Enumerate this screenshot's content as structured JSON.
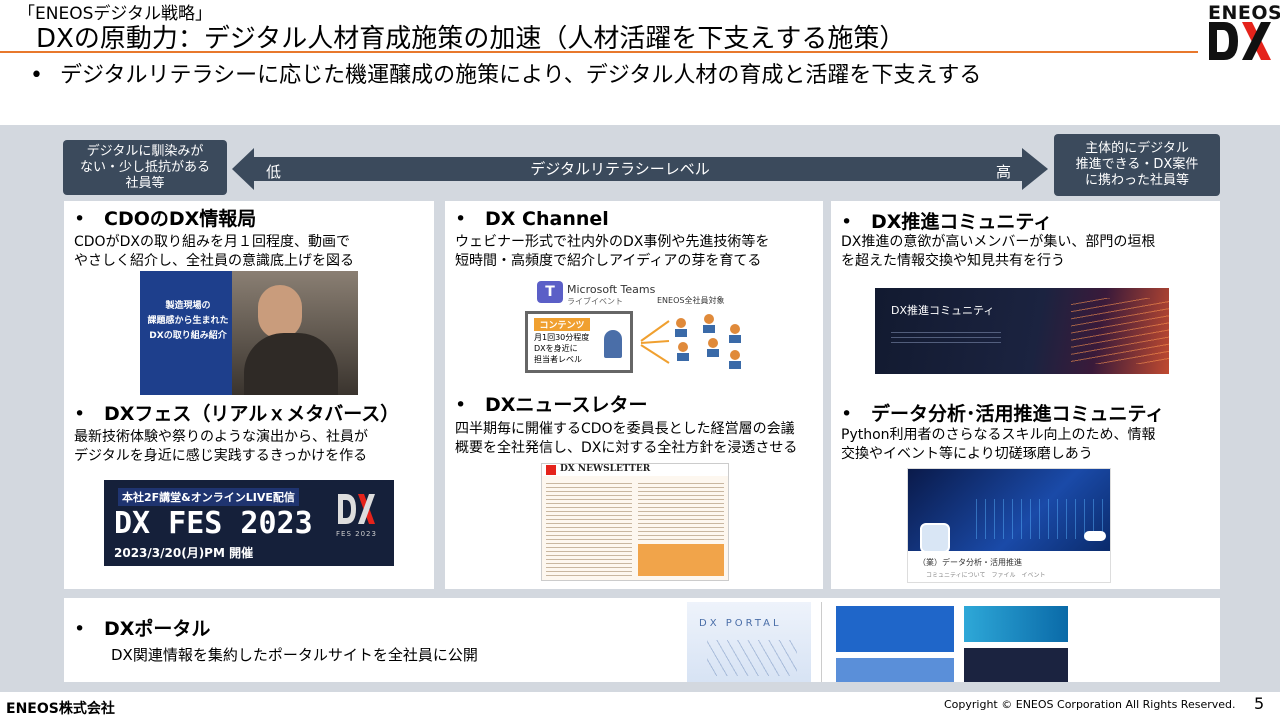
{
  "header": {
    "tag": "「ENEOSデジタル戦略」",
    "title": "DXの原動力：デジタル人材育成施策の加速（人材活躍を下支えする施策）",
    "logo_word": "ENEOS",
    "logo_mark": "DX",
    "lead": "デジタルリテラシーに応じた機運醸成の施策により、デジタル人材の育成と活躍を下支えする"
  },
  "literacy": {
    "left_box": "デジタルに馴染みが\nない・少し抵抗がある\n社員等",
    "right_box": "主体的にデジタル\n推進できる・DX案件\nに携わった社員等",
    "low": "低",
    "label": "デジタルリテラシーレベル",
    "high": "高"
  },
  "panels": {
    "cdo": {
      "title": "CDOのDX情報局",
      "text": "CDOがDXの取り組みを月１回程度、動画で\nやさしく紹介し、全社員の意識底上げを図る",
      "thumb_lines": [
        "製造現場の",
        "課題感から生まれた",
        "DXの取り組み紹介"
      ]
    },
    "fes": {
      "title": "DXフェス（リアルｘメタバース）",
      "text": "最新技術体験や祭りのような演出から、社員が\nデジタルを身近に感じ実践するきっかけを作る",
      "banner_top": "本社2F講堂&オンラインLIVE配信",
      "banner_main": "DX FES 2023",
      "banner_date": "2023/3/20(月)PM 開催",
      "banner_sub": "FES 2023"
    },
    "channel": {
      "title": "DX Channel",
      "text": "ウェビナー形式で社内外のDX事例や先進技術等を\n短時間・高頻度で紹介しアイディアの芽を育てる",
      "teams": "Microsoft Teams",
      "teams_sub": "ライブイベント",
      "target": "ENEOS全社員対象",
      "contents_title": "コンテンツ",
      "contents": [
        "月1回30分程度",
        "DXを身近に",
        "担当者レベル"
      ]
    },
    "newsletter": {
      "title": "DXニュースレター",
      "text": "四半期毎に開催するCDOを委員長とした経営層の会議\n概要を全社発信し、DXに対する全社方針を浸透させる",
      "masthead": "DX NEWSLETTER"
    },
    "community": {
      "title": "DX推進コミュニティ",
      "text": "DX推進の意欲が高いメンバーが集い、部門の垣根\nを超えた情報交換や知見共有を行う",
      "banner": "DX推進コミュニティ"
    },
    "data": {
      "title": "データ分析･活用推進コミュニティ",
      "text": "Python利用者のさらなるスキル向上のため、情報\n交換やイベント等により切磋琢磨しあう",
      "caption": "（業）データ分析・活用推進",
      "tabs": "コミュニティについて　ファイル　イベント"
    },
    "portal": {
      "title": "DXポータル",
      "text": "DX関連情報を集約したポータルサイトを全社員に公開",
      "portal_word": "DX PORTAL"
    }
  },
  "footer": {
    "company": "ENEOS株式会社",
    "copyright": "Copyright © ENEOS Corporation  All Rights Reserved.",
    "page": "5"
  },
  "colors": {
    "accent_line": "#e8782c",
    "band": "#d3d8df",
    "navy": "#3b4a5c",
    "logo_red": "#e5231b"
  }
}
